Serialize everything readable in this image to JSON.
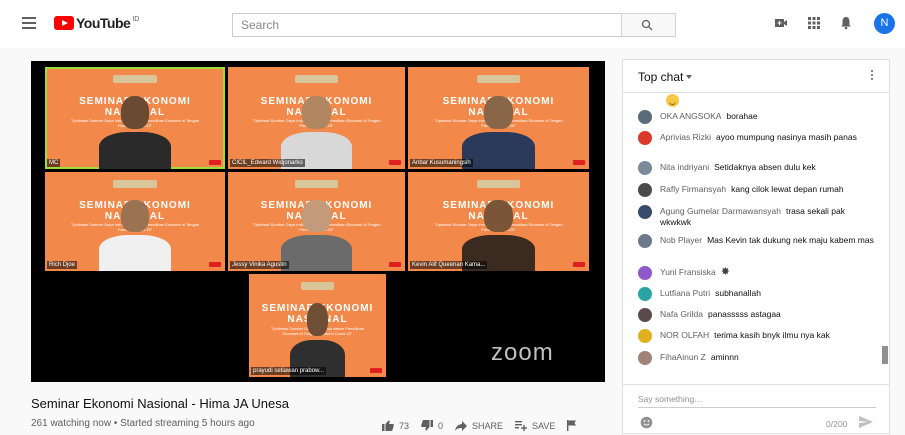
{
  "header": {
    "logo_text": "YouTube",
    "logo_country": "ID",
    "search_placeholder": "Search",
    "avatar_letter": "N"
  },
  "video": {
    "participants": [
      {
        "name": "MC",
        "banner": "SEMINAR EKONOMI NASIONAL",
        "active": true
      },
      {
        "name": "CICIL_Edward Widjonarko",
        "banner": "SEMINAR EKONOMI NASIONAL",
        "active": false
      },
      {
        "name": "Anbar Kusumaningsih",
        "banner": "SEMINAR EKONOMI NASIONAL",
        "active": false
      },
      {
        "name": "Rich Djoe",
        "banner": "SEMINAR EKONOMI NASIONAL",
        "active": false
      },
      {
        "name": "Jessy Vinika Agustin",
        "banner": "SEMINAR EKONOMI NASIONAL",
        "active": false
      },
      {
        "name": "Kevin Alif Queenan Kama...",
        "banner": "SEMINAR EKONOMI NASIONAL",
        "active": false
      },
      {
        "name": "prayudi setiawan prabow...",
        "banner": "SEMINAR EKONOMI NASIONAL",
        "active": false
      }
    ],
    "banner_subtitle": "\"Optimasi Sumber Daya Indonesia dalam Pemulihan Ekonomi di Tengah Pandemi Covid-19\"",
    "zoom_watermark": "zoom",
    "title": "Seminar Ekonomi Nasional - Hima JA Unesa",
    "meta": "261 watching now • Started streaming 5 hours ago",
    "likes": "73",
    "dislikes": "0",
    "share_label": "SHARE",
    "save_label": "SAVE"
  },
  "chat": {
    "title": "Top chat",
    "messages": [
      {
        "author": "OKA ANGSOKA",
        "text": "borahae",
        "avatar_color": "#5a6b7a"
      },
      {
        "author": "Aprivias Rizki",
        "text": "ayoo mumpung nasinya masih panas",
        "avatar_color": "#d93a2a"
      },
      {
        "author": "Nita indriyani",
        "text": "Setidaknya absen dulu kek",
        "avatar_color": "#7a8a99"
      },
      {
        "author": "Rafly Firmansyah",
        "text": "kang cilok lewat depan rumah",
        "avatar_color": "#4a4a4a"
      },
      {
        "author": "Agung Gumelar Darmawansyah",
        "text": "trasa sekali pak wkwkwk",
        "avatar_color": "#3a4a6a"
      },
      {
        "author": "Nob Player",
        "text": "Mas Kevin tak dukung nek maju kabem mas",
        "avatar_color": "#6a7a8a"
      },
      {
        "author": "Yuni Fransiska",
        "text": "",
        "avatar_color": "#8e5ac9"
      },
      {
        "author": "Lutfiana Putri",
        "text": "subhanallah",
        "avatar_color": "#2aa3a3"
      },
      {
        "author": "Nafa Grilda",
        "text": "panasssss astagaa",
        "avatar_color": "#5a4a4a"
      },
      {
        "author": "NOR OLFAH",
        "text": "terima kasih bnyk ilmu nya kak",
        "avatar_color": "#e0b020"
      },
      {
        "author": "FihaAinun Z",
        "text": "aminnn",
        "avatar_color": "#a0847a"
      }
    ],
    "input_placeholder": "Say something...",
    "counter": "0/200"
  }
}
